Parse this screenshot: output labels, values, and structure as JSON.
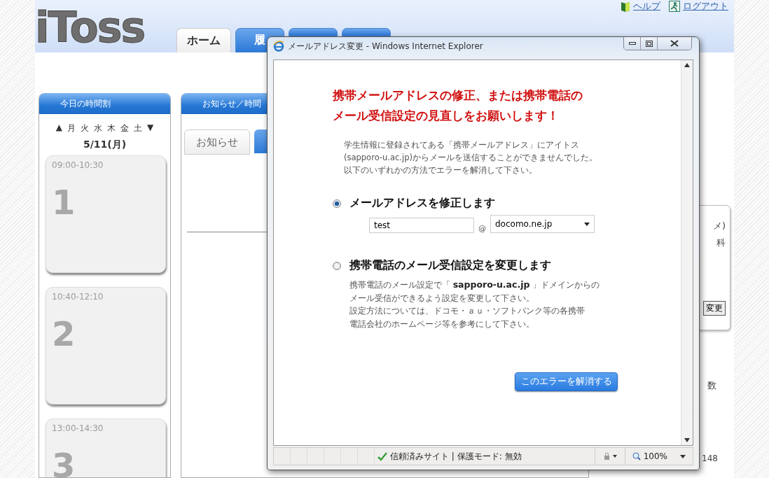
{
  "page": {
    "logo": "iToss",
    "tabs": [
      {
        "label": "ホーム",
        "selected": true
      },
      {
        "label": "履",
        "selected": false
      },
      {
        "selected": false
      },
      {
        "selected": false
      }
    ],
    "header_links": [
      {
        "kind": "help",
        "label": "ヘルプ"
      },
      {
        "kind": "logout",
        "label": "ログアウト"
      }
    ]
  },
  "timetable": {
    "title": "今日の時間割",
    "prev": "▲",
    "next": "▼",
    "days": [
      "月",
      "火",
      "水",
      "木",
      "金",
      "土"
    ],
    "date": "5/11(月)",
    "periods": [
      {
        "time": "09:00-10:30",
        "number": "1"
      },
      {
        "time": "10:40-12:10",
        "number": "2"
      },
      {
        "time": "13:00-14:30",
        "number": "3"
      }
    ]
  },
  "notice_panel": {
    "title": "お知らせ／時間",
    "tabs": [
      {
        "label": "お知らせ",
        "selected": true
      },
      {
        "selected": false
      }
    ]
  },
  "right_panel": {
    "texts": [
      "メ)",
      "科"
    ],
    "button": "変更",
    "column_heading": "数",
    "count": "148"
  },
  "popup": {
    "title": "メールアドレス変更 - Windows Internet Explorer",
    "heading": [
      "携帯メールアドレスの修正、または携帯電話の",
      "メール受信設定の見直しをお願いします！"
    ],
    "intro": [
      "学生情報に登録されてある「携帯メールアドレス」にアイトス",
      "(sapporo-u.ac.jp)からメールを送信することができませんでした。",
      "以下のいずれかの方法でエラーを解消して下さい。"
    ],
    "options": [
      {
        "kind": "address",
        "label": "メールアドレスを修正します",
        "selected": true,
        "local_part": "test",
        "at": "@",
        "domain": "docomo.ne.jp"
      },
      {
        "kind": "settings",
        "label": "携帯電話のメール受信設定を変更します",
        "selected": false,
        "description": [
          "携帯電話のメール設定で「 **sapporo-u.ac.jp** 」ドメインからの",
          "メール受信ができるよう設定を変更して下さい。",
          "設定方法については、ドコモ・ａｕ・ソフトバンク等の各携帯",
          "電話会社のホームページ等を参考にして下さい。"
        ]
      }
    ],
    "submit": "このエラーを解消する",
    "status": "信頼済みサイト | 保護モード: 無効",
    "zoom": "100%"
  }
}
